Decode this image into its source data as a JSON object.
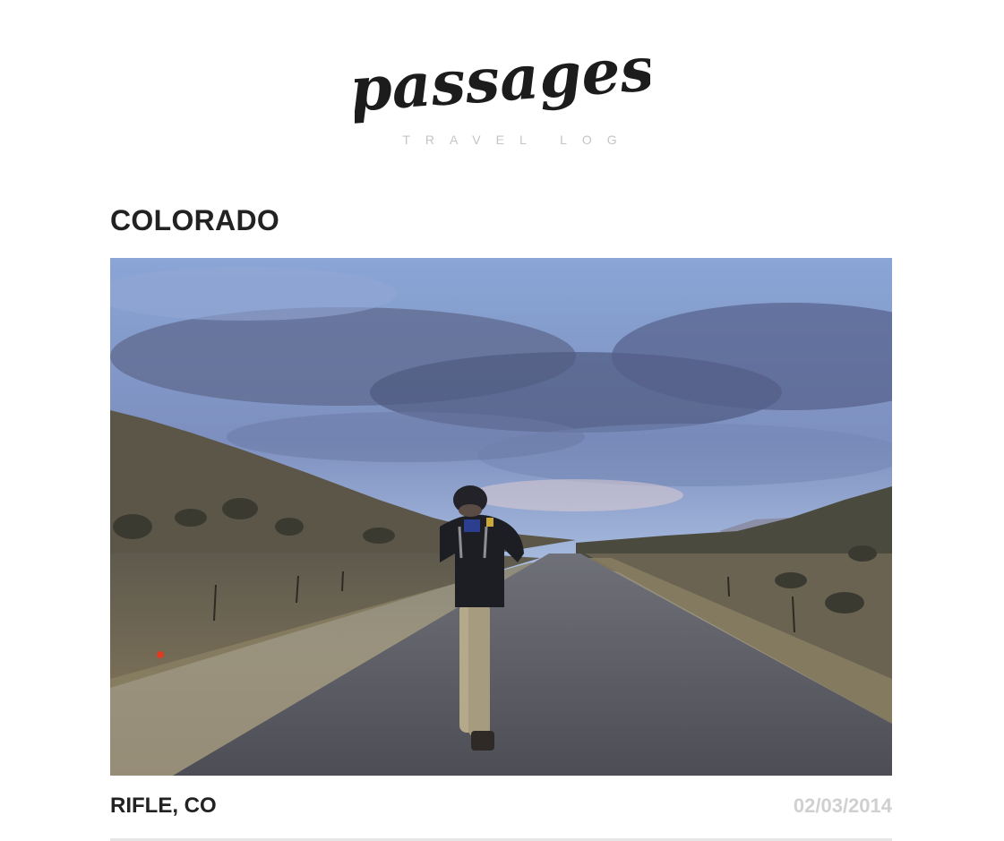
{
  "site": {
    "logo_text": "passages",
    "tagline": "TRAVEL LOG"
  },
  "section": {
    "title": "COLORADO"
  },
  "post": {
    "title": "RIFLE, CO",
    "date": "02/03/2014",
    "photo_alt": "Hiker with backpack walking down a gravel road under a cloudy dusk sky"
  }
}
